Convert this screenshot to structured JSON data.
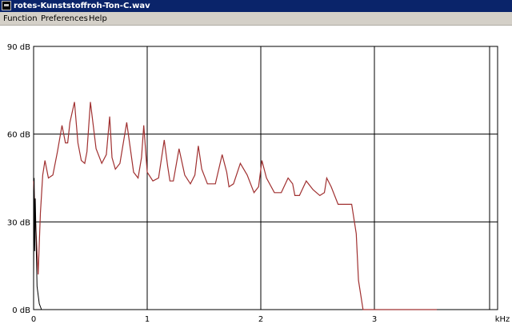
{
  "window": {
    "title": "rotes-Kunststoffroh-Ton-C.wav",
    "icon": "app-icon"
  },
  "menu": {
    "items": [
      "Function",
      "Preferences",
      "Help"
    ]
  },
  "colors": {
    "titlebar": "#0a246a",
    "menubar": "#d4d0c8",
    "curve": "#a03030",
    "grid": "#000000"
  },
  "chart_data": {
    "type": "line",
    "title": "",
    "xlabel": "kHz",
    "ylabel": "",
    "xlim": [
      0,
      4.0
    ],
    "ylim": [
      0,
      90
    ],
    "xticks": [
      0,
      1,
      2,
      3
    ],
    "yticks": [
      0,
      30,
      60,
      90
    ],
    "ytick_labels": [
      "0 dB",
      "30 dB",
      "60 dB",
      "90 dB"
    ],
    "grid": true,
    "series": [
      {
        "x": [
          0.0,
          0.02,
          0.04,
          0.06,
          0.08,
          0.1,
          0.13,
          0.17,
          0.21,
          0.25,
          0.28,
          0.3,
          0.32,
          0.36,
          0.39,
          0.42,
          0.45,
          0.47,
          0.5,
          0.55,
          0.6,
          0.64,
          0.67,
          0.69,
          0.72,
          0.76,
          0.82,
          0.88,
          0.92,
          0.95,
          0.97,
          1.0,
          1.05,
          1.1,
          1.15,
          1.18,
          1.2,
          1.23,
          1.28,
          1.33,
          1.38,
          1.42,
          1.45,
          1.48,
          1.53,
          1.6,
          1.66,
          1.7,
          1.72,
          1.76,
          1.82,
          1.88,
          1.94,
          1.98,
          2.01,
          2.05,
          2.12,
          2.18,
          2.24,
          2.28,
          2.3,
          2.34,
          2.4,
          2.46,
          2.52,
          2.56,
          2.58,
          2.62,
          2.68,
          2.75,
          2.8,
          2.84,
          2.86,
          2.9,
          2.96,
          3.02,
          3.08,
          3.12,
          3.16,
          3.2,
          3.26,
          3.32,
          3.36,
          3.4,
          3.44,
          3.47,
          3.5,
          3.51,
          3.52,
          3.53,
          3.54,
          3.55
        ],
        "y": [
          44,
          28,
          12,
          33,
          46,
          51,
          45,
          46,
          54,
          63,
          57,
          57,
          64,
          71,
          57,
          51,
          50,
          54,
          71,
          55,
          50,
          53,
          66,
          52,
          48,
          50,
          64,
          47,
          45,
          52,
          63,
          47,
          44,
          45,
          58,
          49,
          44,
          44,
          55,
          46,
          43,
          46,
          56,
          48,
          43,
          43,
          53,
          47,
          42,
          43,
          50,
          46,
          40,
          42,
          51,
          45,
          40,
          40,
          45,
          43,
          39,
          39,
          44,
          41,
          39,
          40,
          45,
          42,
          36,
          36,
          36,
          26,
          10,
          0,
          0,
          0,
          0,
          0,
          0,
          0,
          0,
          0,
          0,
          0,
          0,
          0,
          0,
          0,
          0,
          0,
          0,
          0
        ]
      }
    ],
    "baseline_series": {
      "x": [
        0.0,
        0.005,
        0.01,
        0.015,
        0.02,
        0.03,
        0.05,
        0.07
      ],
      "y": [
        11,
        45,
        20,
        38,
        28,
        8,
        2,
        0
      ]
    }
  }
}
